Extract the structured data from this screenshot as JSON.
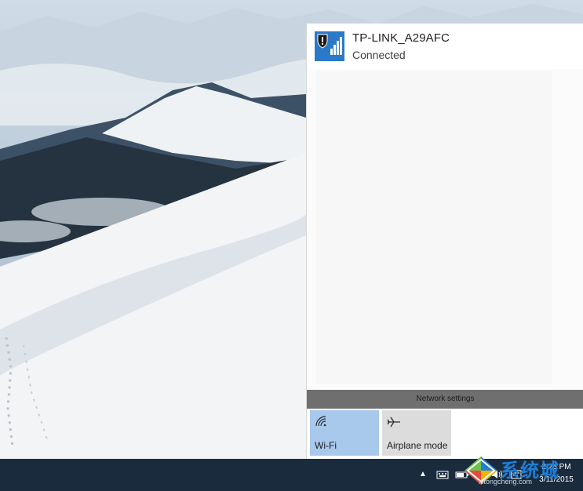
{
  "network": {
    "name": "TP-LINK_A29AFC",
    "status": "Connected",
    "icon": "wifi-shield-warning-icon"
  },
  "flyout": {
    "network_settings_label": "Network settings"
  },
  "quick_actions": [
    {
      "label": "Wi-Fi",
      "icon": "wifi-icon",
      "active": true
    },
    {
      "label": "Airplane mode",
      "icon": "airplane-icon",
      "active": false
    }
  ],
  "taskbar": {
    "time": "2:26 PM",
    "date": "3/11/2015"
  },
  "watermark": {
    "text": "系统城",
    "sub": "xitongcheng.com"
  },
  "colors": {
    "accent": "#2b79c9",
    "taskbar": "#1b2b3e",
    "wifi_tile": "#a8c8ec"
  }
}
